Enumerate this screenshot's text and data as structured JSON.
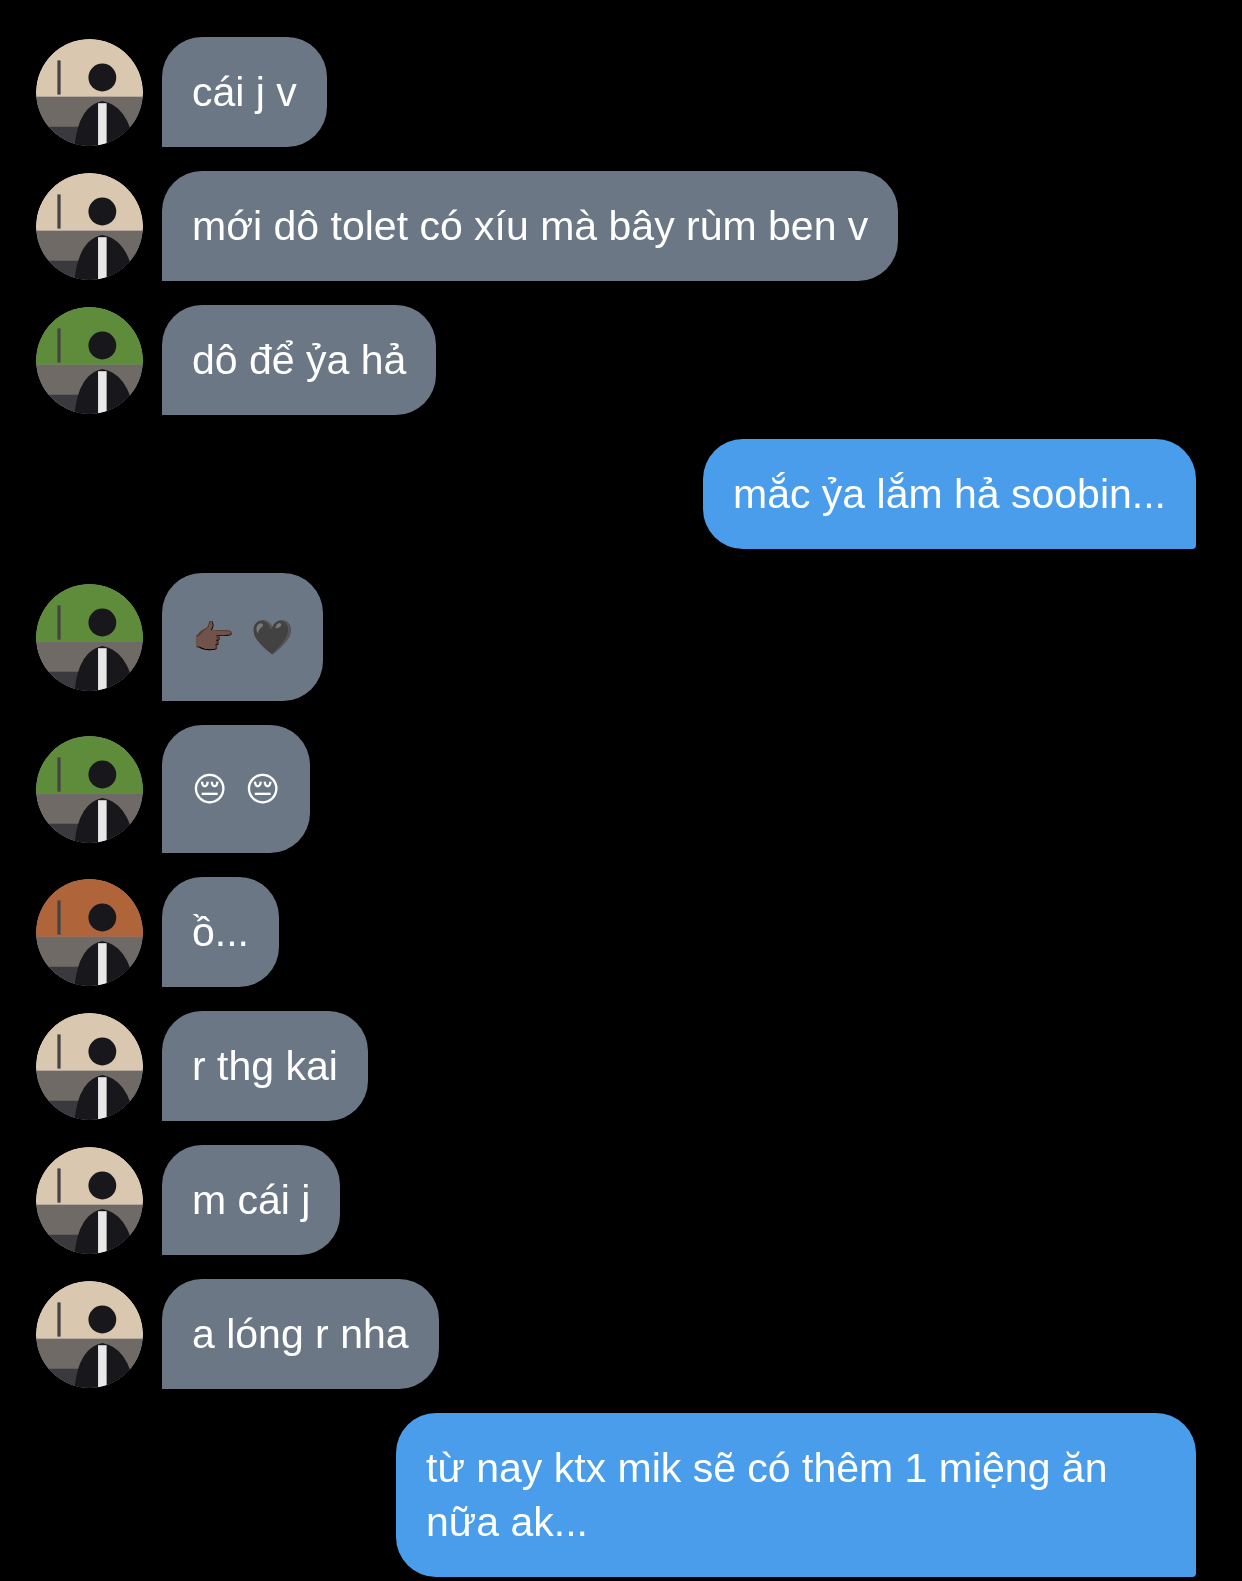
{
  "messages": [
    {
      "kind": "incoming",
      "text": "cái j v"
    },
    {
      "kind": "incoming",
      "text": "mới dô tolet có xíu mà bây rùm ben v"
    },
    {
      "kind": "incoming",
      "text": "dô để ỷa hả"
    },
    {
      "kind": "outgoing",
      "text": "mắc ỷa lắm hả soobin..."
    },
    {
      "kind": "emoji",
      "text": "👉🏿 🖤"
    },
    {
      "kind": "emoji",
      "text": "😔 😔"
    },
    {
      "kind": "incoming",
      "text": "ồ..."
    },
    {
      "kind": "incoming",
      "text": "r thg kai"
    },
    {
      "kind": "incoming",
      "text": "m cái j"
    },
    {
      "kind": "incoming",
      "text": "a lóng r nha"
    },
    {
      "kind": "outgoing",
      "text": "từ nay ktx mik sẽ có thêm 1 miệng ăn nữa ak..."
    }
  ]
}
